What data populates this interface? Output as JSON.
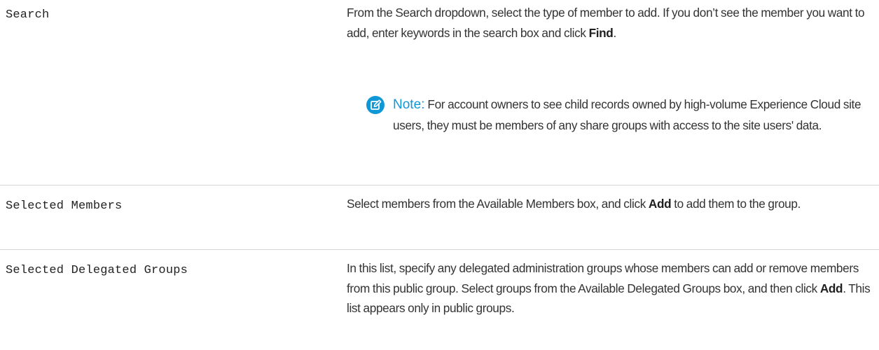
{
  "rows": [
    {
      "field": "Search",
      "desc_parts": {
        "p1": "From the Search dropdown, select the type of member to add. If you don’t see the member you want to add, enter keywords in the search box and click ",
        "bold": "Find",
        "p2": "."
      },
      "note": {
        "label": "Note:",
        "text": "For account owners to see child records owned by high-volume Experience Cloud site users, they must be members of any share groups with access to the site users' data."
      }
    },
    {
      "field": "Selected Members",
      "desc_parts": {
        "p1": "Select members from the Available Members box, and click ",
        "bold": "Add",
        "p2": " to add them to the group."
      }
    },
    {
      "field": "Selected Delegated Groups",
      "desc_parts": {
        "p1": "In this list, specify any delegated administration groups whose members can add or remove members from this public group. Select groups from the Available Delegated Groups box, and then click ",
        "bold": "Add",
        "p2": ". This list appears only in public groups."
      }
    }
  ],
  "colors": {
    "note_accent": "#0f97d6",
    "divider": "#d4d4d4",
    "text": "#333333"
  },
  "icons": {
    "note": "note-edit-icon"
  }
}
